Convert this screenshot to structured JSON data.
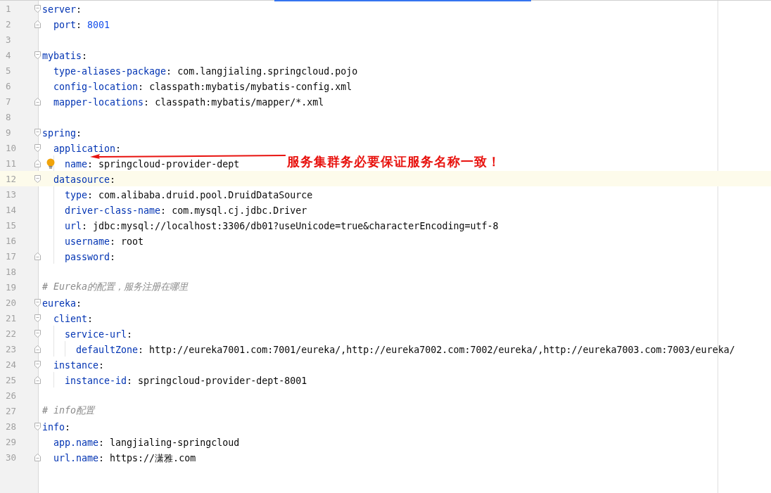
{
  "editor": {
    "lines": [
      {
        "number": "1",
        "kind": "key",
        "key": "server",
        "sep": ":",
        "children": [
          {
            "number": "2",
            "kind": "number",
            "key": "port",
            "sep": ":",
            "value": "8001"
          }
        ]
      },
      {
        "number": "3",
        "kind": "blank"
      },
      {
        "number": "4",
        "kind": "key",
        "key": "mybatis",
        "sep": ":",
        "children": [
          {
            "number": "5",
            "kind": "key",
            "key": "type-aliases-package",
            "sep": ":",
            "value": "com.langjialing.springcloud.pojo"
          },
          {
            "number": "6",
            "kind": "key",
            "key": "config-location",
            "sep": ":",
            "value": "classpath:mybatis/mybatis-config.xml"
          },
          {
            "number": "7",
            "kind": "key",
            "key": "mapper-locations",
            "sep": ":",
            "value": "classpath:mybatis/mapper/*.xml"
          }
        ]
      },
      {
        "number": "8",
        "kind": "blank"
      },
      {
        "number": "9",
        "kind": "key",
        "key": "spring",
        "sep": ":",
        "children": [
          {
            "number": "10",
            "kind": "key",
            "key": "application",
            "sep": ":",
            "children": [
              {
                "number": "11",
                "kind": "key",
                "key": "name",
                "sep": ":",
                "value": "springcloud-provider-dept",
                "bulb": true,
                "annotation": "服务集群务必要保证服务名称一致！"
              }
            ]
          },
          {
            "number": "12",
            "kind": "key",
            "key": "datasource",
            "sep": ":",
            "current": true,
            "children": [
              {
                "number": "13",
                "kind": "key",
                "key": "type",
                "sep": ":",
                "value": "com.alibaba.druid.pool.DruidDataSource"
              },
              {
                "number": "14",
                "kind": "key",
                "key": "driver-class-name",
                "sep": ":",
                "value": "com.mysql.cj.jdbc.Driver"
              },
              {
                "number": "15",
                "kind": "key",
                "key": "url",
                "sep": ":",
                "value": "jdbc:mysql://localhost:3306/db01?useUnicode=true&characterEncoding=utf-8"
              },
              {
                "number": "16",
                "kind": "key",
                "key": "username",
                "sep": ":",
                "value": "root"
              },
              {
                "number": "17",
                "kind": "key",
                "key": "password",
                "sep": ":"
              }
            ]
          }
        ]
      },
      {
        "number": "18",
        "kind": "blank"
      },
      {
        "number": "19",
        "kind": "comment",
        "text": "# Eureka的配置，服务注册在哪里"
      },
      {
        "number": "20",
        "kind": "key",
        "key": "eureka",
        "sep": ":",
        "children": [
          {
            "number": "21",
            "kind": "key",
            "key": "client",
            "sep": ":",
            "children": [
              {
                "number": "22",
                "kind": "key",
                "key": "service-url",
                "sep": ":",
                "children": [
                  {
                    "number": "23",
                    "kind": "key",
                    "key": "defaultZone",
                    "sep": ":",
                    "value": "http://eureka7001.com:7001/eureka/,http://eureka7002.com:7002/eureka/,http://eureka7003.com:7003/eureka/"
                  }
                ]
              }
            ]
          },
          {
            "number": "24",
            "kind": "key",
            "key": "instance",
            "sep": ":",
            "children": [
              {
                "number": "25",
                "kind": "key",
                "key": "instance-id",
                "sep": ":",
                "value": "springcloud-provider-dept-8001"
              }
            ]
          }
        ]
      },
      {
        "number": "26",
        "kind": "blank"
      },
      {
        "number": "27",
        "kind": "comment",
        "text": "# info配置"
      },
      {
        "number": "28",
        "kind": "key",
        "key": "info",
        "sep": ":",
        "children": [
          {
            "number": "29",
            "kind": "key",
            "key": "app.name",
            "sep": ":",
            "value": "langjialing-springcloud"
          },
          {
            "number": "30",
            "kind": "key",
            "key": "url.name",
            "sep": ":",
            "value": "https://潇雅.com"
          }
        ]
      }
    ]
  }
}
